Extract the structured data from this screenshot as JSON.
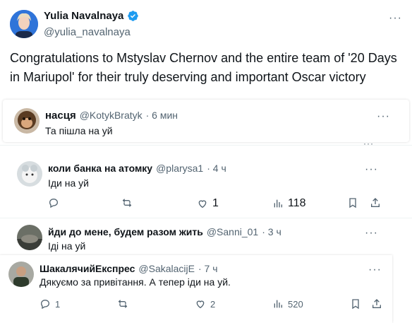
{
  "main_tweet": {
    "author_name": "Yulia Navalnaya",
    "author_handle": "@yulia_navalnaya",
    "verified_badge": "verified-badge",
    "text": "Congratulations to Mstyslav Chernov and the entire team of '20 Days in Mariupol' for their truly deserving and important Oscar victory"
  },
  "replies": [
    {
      "author_name": "насця",
      "author_handle": "@KotykBratyk",
      "time": "· 6 мин",
      "text": "Та пішла на  уй"
    },
    {
      "author_name": "коли банка на атомку",
      "author_handle": "@plarysa1",
      "time": "· 4 ч",
      "text": "Іди на  уй",
      "retweets": "",
      "likes": "1",
      "views": "118"
    },
    {
      "author_name": "йди до мене, будем разом жить",
      "author_handle": "@Sanni_01",
      "time": "· 3 ч",
      "text": "Іді на  уй"
    },
    {
      "author_name": "ШакалячийЕкспрес",
      "author_handle": "@SakalacijE",
      "time": "· 7 ч",
      "text": "Дякуємо за привітання. А тепер іди на  уй.",
      "replies_count": "1",
      "likes": "2",
      "views": "520"
    }
  ],
  "colors": {
    "text": "#0f1419",
    "secondary": "#536471",
    "verified": "#1d9bf0"
  }
}
